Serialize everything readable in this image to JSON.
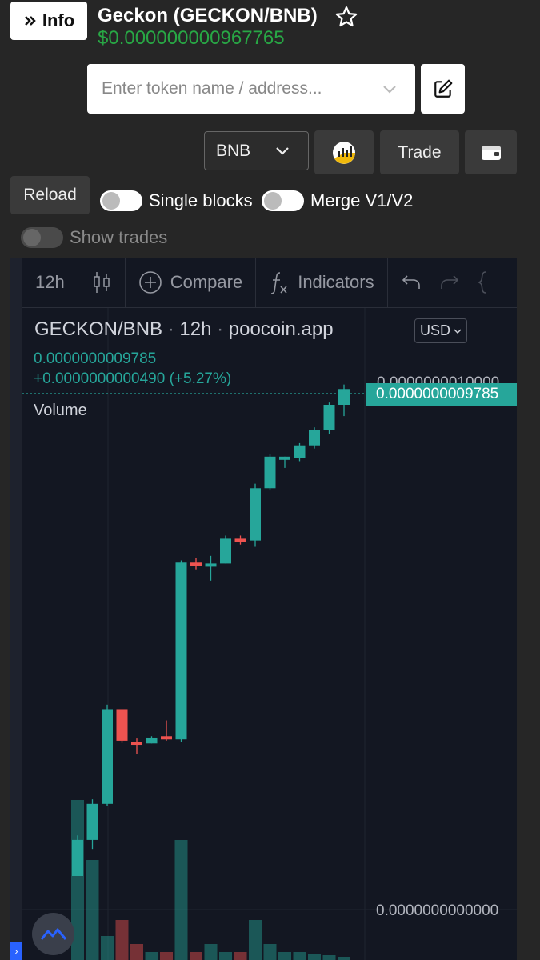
{
  "header": {
    "info_label": "Info",
    "token_name": "Geckon (GECKON/BNB)",
    "token_price": "$0.000000000967765"
  },
  "search": {
    "placeholder": "Enter token name / address..."
  },
  "controls": {
    "network": "BNB",
    "trade_label": "Trade",
    "reload_label": "Reload",
    "single_blocks_label": "Single blocks",
    "merge_label": "Merge V1/V2",
    "show_trades_label": "Show trades"
  },
  "chart_toolbar": {
    "interval": "12h",
    "compare_label": "Compare",
    "indicators_label": "Indicators"
  },
  "chart_legend": {
    "symbol": "GECKON/BNB",
    "interval": "12h",
    "source": "poocoin.app",
    "currency": "USD",
    "last_price": "0.0000000009785",
    "change": "+0.0000000000490 (+5.27%)",
    "volume_label": "Volume",
    "top_axis_tick": "0.0000000010000",
    "price_marker": "0.0000000009785",
    "zero_axis_tick": "0.0000000000000"
  },
  "colors": {
    "up": "#26a69a",
    "down": "#ef5350",
    "price_green": "#28a745",
    "chart_bg": "#131722",
    "page_bg": "#262626"
  },
  "chart_data": {
    "type": "candlestick",
    "ohlc_price_unit": "×1e-12 USD",
    "candles": [
      {
        "o": 0,
        "h": 90,
        "l": 0,
        "c": 80,
        "dir": "up"
      },
      {
        "o": 80,
        "h": 170,
        "l": 60,
        "c": 160,
        "dir": "up"
      },
      {
        "o": 160,
        "h": 380,
        "l": 155,
        "c": 370,
        "dir": "up"
      },
      {
        "o": 370,
        "h": 370,
        "l": 295,
        "c": 300,
        "dir": "down"
      },
      {
        "o": 298,
        "h": 305,
        "l": 270,
        "c": 294,
        "dir": "down"
      },
      {
        "o": 294,
        "h": 310,
        "l": 294,
        "c": 307,
        "dir": "up"
      },
      {
        "o": 310,
        "h": 345,
        "l": 300,
        "c": 303,
        "dir": "down"
      },
      {
        "o": 303,
        "h": 700,
        "l": 298,
        "c": 695,
        "dir": "up"
      },
      {
        "o": 695,
        "h": 705,
        "l": 680,
        "c": 690,
        "dir": "down"
      },
      {
        "o": 690,
        "h": 710,
        "l": 655,
        "c": 693,
        "dir": "up"
      },
      {
        "o": 693,
        "h": 755,
        "l": 693,
        "c": 748,
        "dir": "up"
      },
      {
        "o": 748,
        "h": 755,
        "l": 735,
        "c": 744,
        "dir": "down"
      },
      {
        "o": 744,
        "h": 870,
        "l": 730,
        "c": 860,
        "dir": "up"
      },
      {
        "o": 860,
        "h": 935,
        "l": 855,
        "c": 930,
        "dir": "up"
      },
      {
        "o": 930,
        "h": 930,
        "l": 905,
        "c": 927,
        "dir": "up"
      },
      {
        "o": 927,
        "h": 960,
        "l": 920,
        "c": 955,
        "dir": "up"
      },
      {
        "o": 955,
        "h": 995,
        "l": 948,
        "c": 990,
        "dir": "up"
      },
      {
        "o": 990,
        "h": 1050,
        "l": 980,
        "c": 1045,
        "dir": "up"
      },
      {
        "o": 1045,
        "h": 1090,
        "l": 1020,
        "c": 1080,
        "dir": "up"
      }
    ],
    "volume": [
      200,
      125,
      30,
      50,
      20,
      10,
      10,
      150,
      10,
      20,
      10,
      10,
      50,
      20,
      10,
      10,
      8,
      6,
      4
    ]
  }
}
